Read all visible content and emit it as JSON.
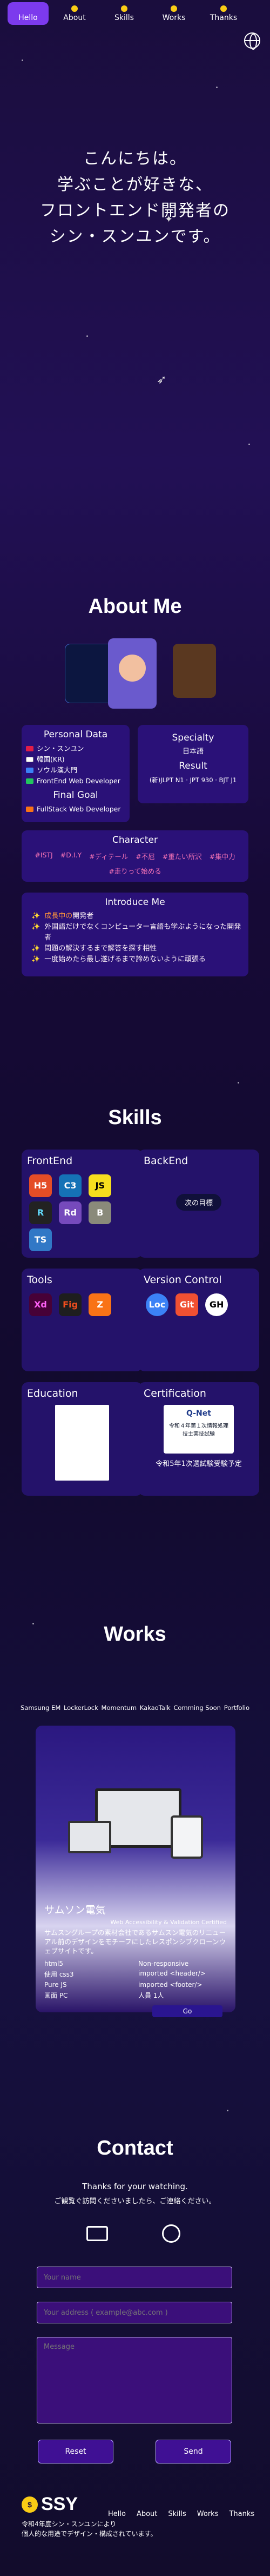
{
  "nav": {
    "items": [
      "Hello",
      "About",
      "Skills",
      "Works",
      "Thanks"
    ]
  },
  "hero": {
    "lines": [
      "こんにちは。",
      "学ぶことが好きな、",
      "フロントエンド開発者の",
      "シン・スンユンです。"
    ]
  },
  "about": {
    "title": "About Me",
    "personal": {
      "title": "Personal Data",
      "rows": [
        "シン・スンユン",
        "韓国(KR)",
        "ソウル漢大門",
        "FrontEnd Web Developer"
      ]
    },
    "final_goal": {
      "title": "Final Goal",
      "value": "FullStack Web Developer"
    },
    "specialty": {
      "title": "Specialty",
      "value": "日本語"
    },
    "result": {
      "title": "Result",
      "value": "(新)JLPT N1 · JPT 930 · BJT J1"
    },
    "character": {
      "title": "Character",
      "tags": [
        "#ISTJ",
        "#D.I.Y",
        "#ディテール",
        "#不屈",
        "#重たい所沢",
        "#集中力",
        "#走りって始める"
      ]
    },
    "intro": {
      "title": "Introduce Me",
      "rows": [
        {
          "hl": "成長中の",
          "text": "開発者"
        },
        {
          "hl": "",
          "text": "外国語だけでなくコンピューター言語も学ぶようになった開発者"
        },
        {
          "hl": "",
          "text": "問題の解決するまで解答を探す相性"
        },
        {
          "hl": "",
          "text": "一度始めたら最し遂げるまで諦めないように頑張る"
        }
      ]
    }
  },
  "skills": {
    "title": "Skills",
    "frontend": {
      "title": "FrontEnd",
      "logos": [
        "H5",
        "C3",
        "JS",
        "R",
        "Rd",
        "B",
        "TS"
      ]
    },
    "backend": {
      "title": "BackEnd",
      "goal": "次の目標"
    },
    "tools": {
      "title": "Tools",
      "logos": [
        "Xd",
        "Fig",
        "Z"
      ]
    },
    "version_control": {
      "title": "Version Control",
      "logos": [
        "Loc",
        "Git",
        "GH"
      ]
    },
    "education": {
      "title": "Education"
    },
    "certification": {
      "title": "Certification",
      "badge": "Q-Net",
      "badge_caption": "令和４年第１次情報処理技士実技試験",
      "text": "令和5年1次選試験受験予定"
    }
  },
  "works": {
    "title": "Works",
    "tabs": [
      "Samsung EM",
      "LockerLock",
      "Momentum",
      "KakaoTalk",
      "Comming Soon",
      "Portfolio"
    ],
    "project": {
      "title": "サムソン電気",
      "subtitle": "Web Accessibility & Validation Certified",
      "desc": "サムスングループの素材会社であるサムスン電気のリニューアル前のデザインをモチーフにしたレスポンシブクローンウェブサイトです。",
      "specs": [
        {
          "left": "html5",
          "right": "Non-responsive"
        },
        {
          "left": "使用 css3",
          "right": "imported <header/>"
        },
        {
          "left": "Pure JS",
          "right": "imported <footer/>"
        },
        {
          "left": "画面 PC",
          "right": "人員 1人"
        }
      ],
      "go": "Go"
    }
  },
  "contact": {
    "title": "Contact",
    "thanks": "Thanks for your watching.",
    "thanks_ja": "ご観覧ぐ訪問くださいましたら、ご連絡ください。",
    "name_ph": "Your name",
    "address_ph": "Your address ( example@abc.com )",
    "message_ph": "Message",
    "reset": "Reset",
    "send": "Send"
  },
  "footer": {
    "logo": "SSY",
    "badge": "$",
    "links": [
      "Hello",
      "About",
      "Skills",
      "Works",
      "Thanks"
    ],
    "sub1": "令和4年度シン・スンユンにより",
    "sub2": "個人的な用途でデザイン・構成されています。"
  }
}
